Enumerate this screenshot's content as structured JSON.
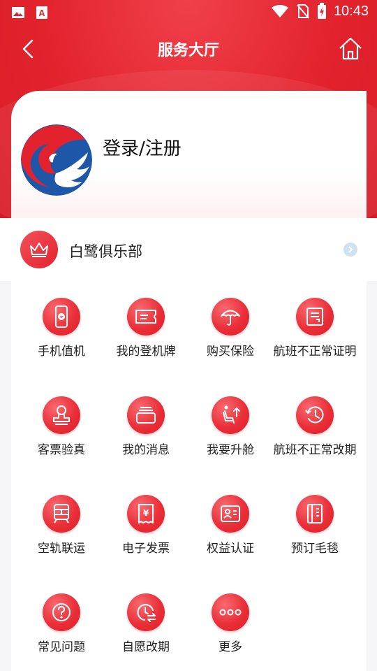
{
  "status_bar": {
    "time": "10:43",
    "icons": [
      "image-icon",
      "font-app-icon",
      "wifi-icon",
      "no-sim-icon",
      "battery-icon"
    ]
  },
  "nav": {
    "title": "服务大厅",
    "back_icon": "chevron-left-icon",
    "home_icon": "home-icon"
  },
  "user": {
    "login_label": "登录/注册"
  },
  "club": {
    "label": "白鹭俱乐部",
    "icon": "crown-icon"
  },
  "services": [
    {
      "label": "手机值机",
      "icon": "phone-checkin-icon"
    },
    {
      "label": "我的登机牌",
      "icon": "boarding-pass-icon"
    },
    {
      "label": "购买保险",
      "icon": "umbrella-icon"
    },
    {
      "label": "航班不正常证明",
      "icon": "certificate-icon"
    },
    {
      "label": "客票验真",
      "icon": "stamp-icon"
    },
    {
      "label": "我的消息",
      "icon": "message-icon"
    },
    {
      "label": "我要升舱",
      "icon": "seat-upgrade-icon"
    },
    {
      "label": "航班不正常改期",
      "icon": "history-clock-icon"
    },
    {
      "label": "空轨联运",
      "icon": "train-icon"
    },
    {
      "label": "电子发票",
      "icon": "invoice-icon"
    },
    {
      "label": "权益认证",
      "icon": "id-card-icon"
    },
    {
      "label": "预订毛毯",
      "icon": "blanket-icon"
    },
    {
      "label": "常见问题",
      "icon": "question-icon"
    },
    {
      "label": "自愿改期",
      "icon": "reschedule-icon"
    },
    {
      "label": "更多",
      "icon": "more-icon"
    }
  ],
  "colors": {
    "brand_red": "#e2232e",
    "card_bg": "#ffffff",
    "page_bg": "#f5f5f7"
  }
}
